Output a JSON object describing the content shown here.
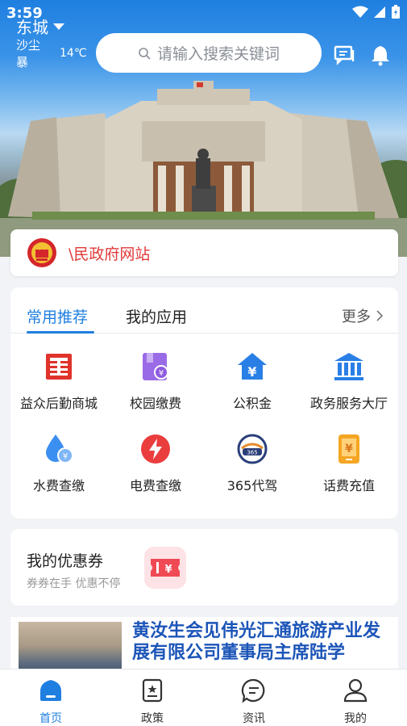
{
  "status_bar": {
    "time": "3:59"
  },
  "header": {
    "city": "东城",
    "weather": "沙尘暴",
    "temperature": "14℃",
    "search_placeholder": "请输入搜索关键词",
    "icons": [
      "message-icon",
      "bell-icon"
    ]
  },
  "gov_banner": {
    "text": "\\民政府网站"
  },
  "apps": {
    "tabs": [
      {
        "label": "常用推荐",
        "active": true
      },
      {
        "label": "我的应用",
        "active": false
      }
    ],
    "more_label": "更多",
    "items": [
      {
        "label": "益众后勤商城",
        "icon": "mall-icon",
        "color": "#e0332b"
      },
      {
        "label": "校园缴费",
        "icon": "campus-pay-icon",
        "color": "#8e5be0"
      },
      {
        "label": "公积金",
        "icon": "housing-fund-icon",
        "color": "#2a7fe6"
      },
      {
        "label": "政务服务大厅",
        "icon": "gov-hall-icon",
        "color": "#2a7fe6"
      },
      {
        "label": "水费查缴",
        "icon": "water-fee-icon",
        "color": "#3b8ff0"
      },
      {
        "label": "电费查缴",
        "icon": "electric-fee-icon",
        "color": "#ea3d3d"
      },
      {
        "label": "365代驾",
        "icon": "driver-icon",
        "color": "#2a3f7a"
      },
      {
        "label": "话费充值",
        "icon": "phone-recharge-icon",
        "color": "#f5a623"
      }
    ]
  },
  "coupon": {
    "title": "我的优惠券",
    "subtitle": "券券在手 优惠不停"
  },
  "news": {
    "title": "黄汝生会见伟光汇通旅游产业发展有限公司董事局主席陆学"
  },
  "tabbar": {
    "items": [
      {
        "label": "首页",
        "active": true
      },
      {
        "label": "政策",
        "active": false
      },
      {
        "label": "资讯",
        "active": false
      },
      {
        "label": "我的",
        "active": false
      }
    ]
  }
}
